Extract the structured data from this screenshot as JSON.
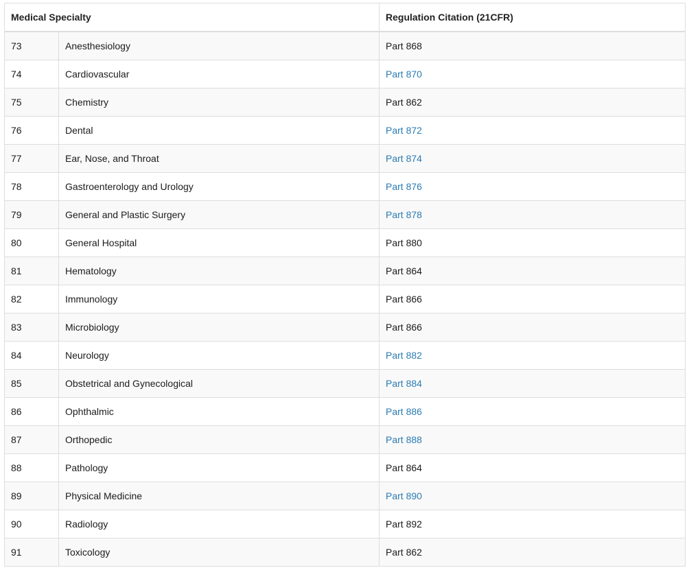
{
  "table": {
    "headers": {
      "specialty": "Medical Specialty",
      "citation": "Regulation Citation (21CFR)"
    },
    "rows": [
      {
        "code": "73",
        "specialty": "Anesthesiology",
        "citation": "Part 868",
        "link": false
      },
      {
        "code": "74",
        "specialty": "Cardiovascular",
        "citation": "Part 870",
        "link": true
      },
      {
        "code": "75",
        "specialty": "Chemistry",
        "citation": "Part 862",
        "link": false
      },
      {
        "code": "76",
        "specialty": "Dental",
        "citation": "Part 872",
        "link": true
      },
      {
        "code": "77",
        "specialty": "Ear, Nose, and Throat",
        "citation": "Part 874",
        "link": true
      },
      {
        "code": "78",
        "specialty": "Gastroenterology and Urology",
        "citation": "Part 876",
        "link": true
      },
      {
        "code": "79",
        "specialty": "General and Plastic Surgery",
        "citation": "Part 878",
        "link": true
      },
      {
        "code": "80",
        "specialty": "General Hospital",
        "citation": "Part 880",
        "link": false
      },
      {
        "code": "81",
        "specialty": "Hematology",
        "citation": "Part 864",
        "link": false
      },
      {
        "code": "82",
        "specialty": "Immunology",
        "citation": "Part 866",
        "link": false
      },
      {
        "code": "83",
        "specialty": "Microbiology",
        "citation": "Part 866",
        "link": false
      },
      {
        "code": "84",
        "specialty": "Neurology",
        "citation": "Part 882",
        "link": true
      },
      {
        "code": "85",
        "specialty": "Obstetrical and Gynecological",
        "citation": "Part 884",
        "link": true
      },
      {
        "code": "86",
        "specialty": "Ophthalmic",
        "citation": "Part 886",
        "link": true
      },
      {
        "code": "87",
        "specialty": "Orthopedic",
        "citation": "Part 888",
        "link": true
      },
      {
        "code": "88",
        "specialty": "Pathology",
        "citation": "Part 864",
        "link": false
      },
      {
        "code": "89",
        "specialty": "Physical Medicine",
        "citation": "Part 890",
        "link": true
      },
      {
        "code": "90",
        "specialty": "Radiology",
        "citation": "Part 892",
        "link": false
      },
      {
        "code": "91",
        "specialty": "Toxicology",
        "citation": "Part 862",
        "link": false
      }
    ]
  },
  "colors": {
    "link": "#2b7bb3",
    "text": "#1b1b1b",
    "stripe": "#f9f9f9",
    "border": "#dddddd"
  }
}
